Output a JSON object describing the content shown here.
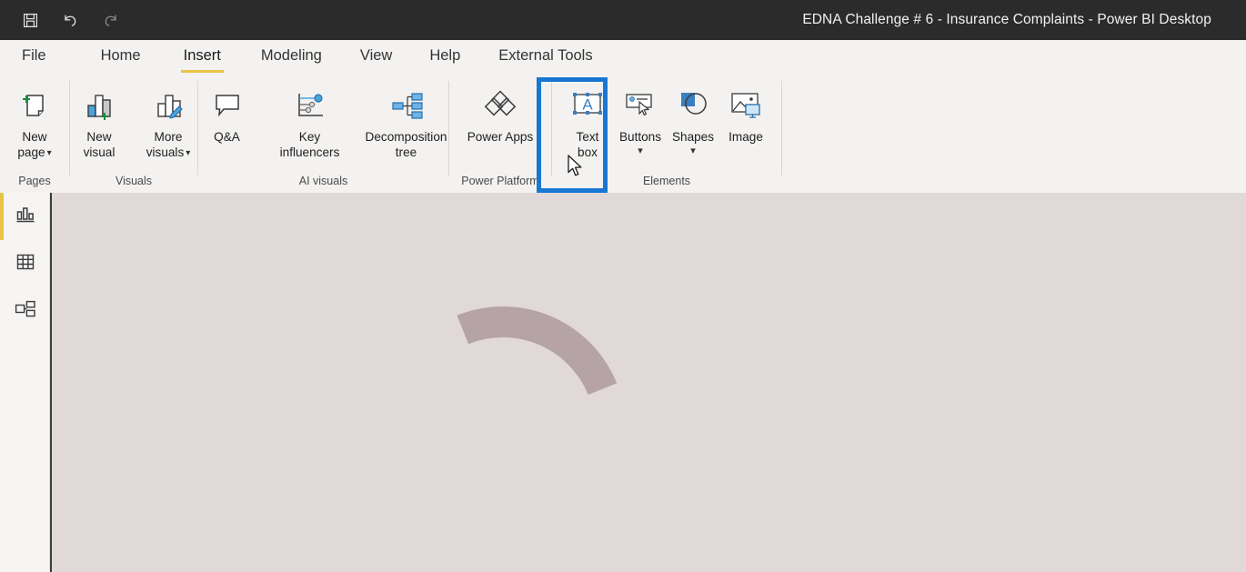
{
  "window": {
    "title": "EDNA Challenge # 6 - Insurance Complaints - Power BI Desktop",
    "quick_access": [
      {
        "name": "save-icon",
        "label": "Save"
      },
      {
        "name": "undo-icon",
        "label": "Undo"
      },
      {
        "name": "redo-icon",
        "label": "Redo"
      }
    ]
  },
  "ribbon": {
    "tabs": [
      {
        "label": "File",
        "active": false
      },
      {
        "label": "Home",
        "active": false
      },
      {
        "label": "Insert",
        "active": true
      },
      {
        "label": "Modeling",
        "active": false
      },
      {
        "label": "View",
        "active": false
      },
      {
        "label": "Help",
        "active": false
      },
      {
        "label": "External Tools",
        "active": false
      }
    ],
    "groups": [
      {
        "label": "Pages",
        "items": [
          {
            "line1": "New",
            "line2": "page",
            "icon": "new-page-icon",
            "dropdown": true
          }
        ]
      },
      {
        "label": "Visuals",
        "items": [
          {
            "line1": "New",
            "line2": "visual",
            "icon": "new-visual-icon",
            "dropdown": false
          },
          {
            "line1": "More",
            "line2": "visuals",
            "icon": "more-visuals-icon",
            "dropdown": true
          }
        ]
      },
      {
        "label": "AI visuals",
        "items": [
          {
            "line1": "Q&A",
            "line2": "",
            "icon": "qna-icon",
            "dropdown": false
          },
          {
            "line1": "Key",
            "line2": "influencers",
            "icon": "key-influencers-icon",
            "dropdown": false
          },
          {
            "line1": "Decomposition",
            "line2": "tree",
            "icon": "decomposition-tree-icon",
            "dropdown": false
          }
        ]
      },
      {
        "label": "Power Platform",
        "items": [
          {
            "line1": "Power Apps",
            "line2": "",
            "icon": "power-apps-icon",
            "dropdown": false
          }
        ]
      },
      {
        "label": "Elements",
        "items": [
          {
            "line1": "Text",
            "line2": "box",
            "icon": "text-box-icon",
            "dropdown": false,
            "highlighted": true
          },
          {
            "line1": "Buttons",
            "line2": "",
            "icon": "buttons-icon",
            "dropdown": true
          },
          {
            "line1": "Shapes",
            "line2": "",
            "icon": "shapes-icon",
            "dropdown": true
          },
          {
            "line1": "Image",
            "line2": "",
            "icon": "image-icon",
            "dropdown": false
          }
        ]
      }
    ],
    "highlight_color": "#1877d2",
    "active_tab_underline_color": "#e7c446"
  },
  "view_bar": {
    "items": [
      {
        "name": "report-view",
        "icon": "bar-chart-icon",
        "active": true
      },
      {
        "name": "data-view",
        "icon": "table-grid-icon",
        "active": false
      },
      {
        "name": "model-view",
        "icon": "relationship-diagram-icon",
        "active": false
      }
    ],
    "active_indicator_color": "#e7c446"
  },
  "canvas": {
    "background_color": "#e1d8da",
    "shapes": [
      {
        "name": "arc-shape",
        "type": "arc",
        "color": "#b5a3a6",
        "start_angle_deg": -90,
        "end_angle_deg": 20,
        "thickness_px": 34
      }
    ]
  }
}
